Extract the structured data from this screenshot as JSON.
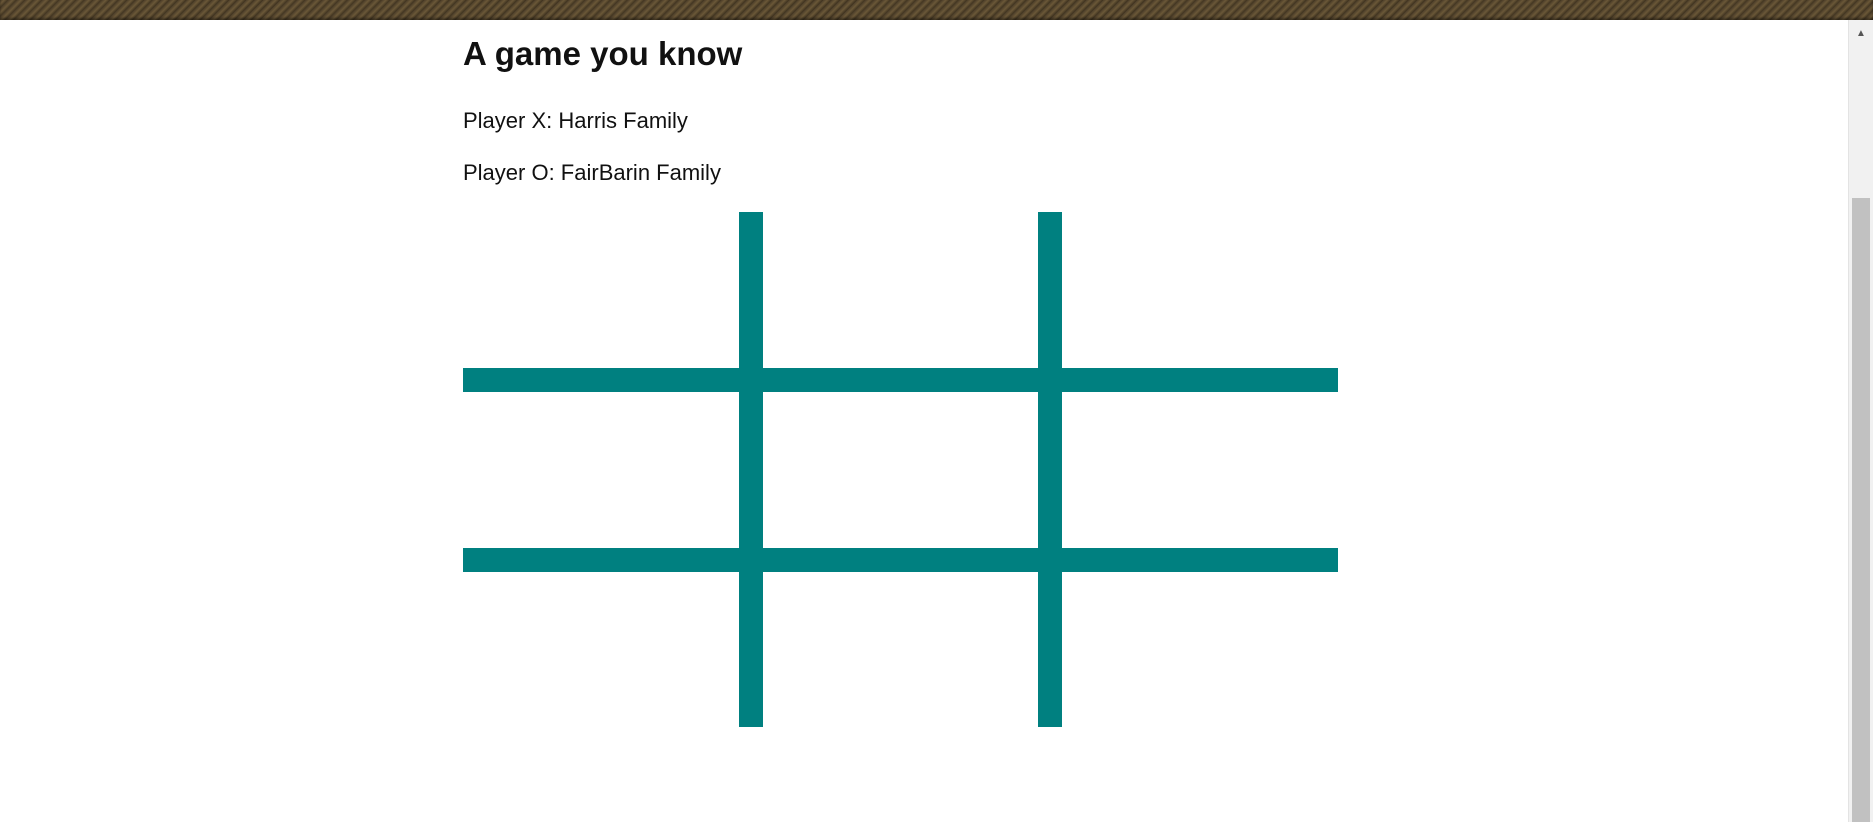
{
  "page": {
    "title": "A game you know",
    "player_x": "Player X: Harris Family",
    "player_o": "Player O: FairBarin Family"
  },
  "board": {
    "line_color": "#008080",
    "rows": 3,
    "cols": 3,
    "cells": [
      "",
      "",
      "",
      "",
      "",
      "",
      "",
      "",
      ""
    ]
  },
  "scrollbar": {
    "up_icon": "scroll-up-arrow-icon"
  }
}
